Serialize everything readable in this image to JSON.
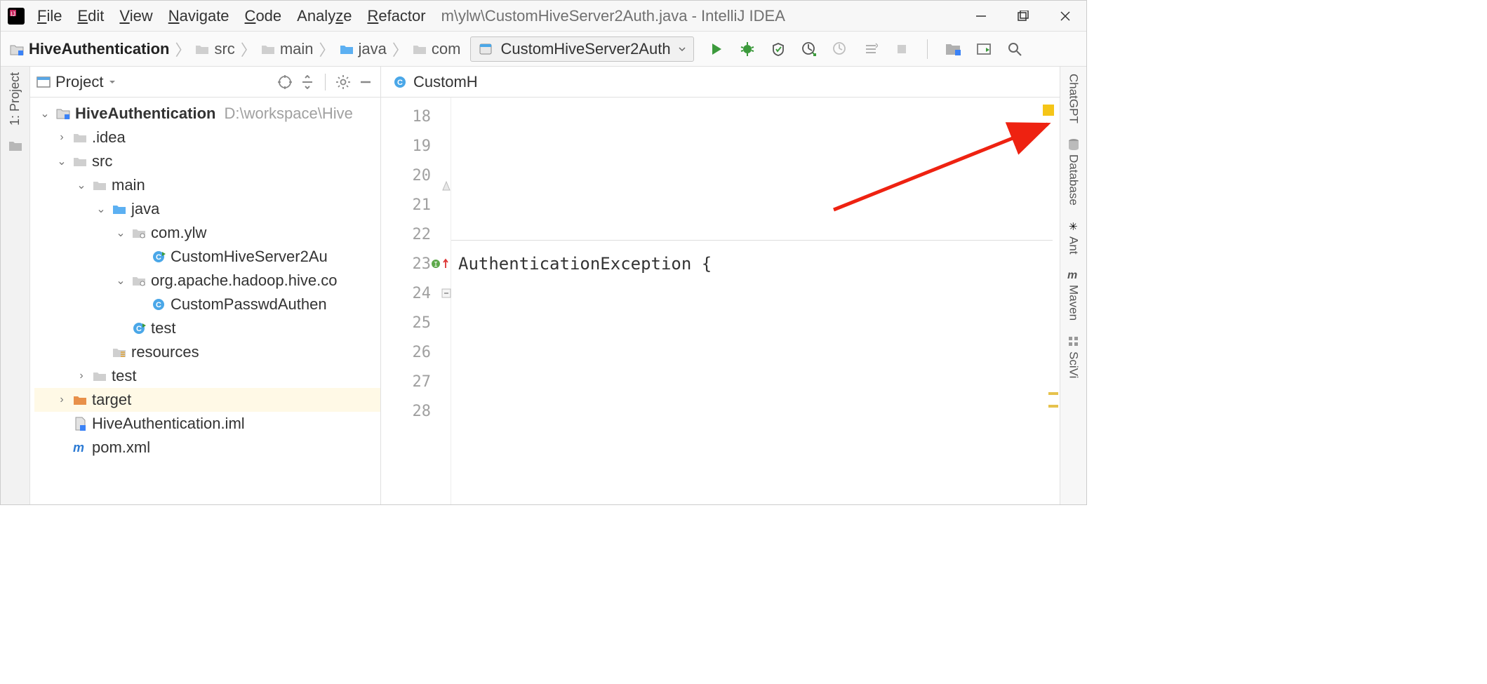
{
  "menu": {
    "file": "File",
    "edit": "Edit",
    "view": "View",
    "navigate": "Navigate",
    "code": "Code",
    "analyze": "Analyze",
    "refactor": "Refactor"
  },
  "title": "m\\ylw\\CustomHiveServer2Auth.java - IntelliJ IDEA",
  "breadcrumb": {
    "root": "HiveAuthentication",
    "src": "src",
    "main": "main",
    "java": "java",
    "com": "com"
  },
  "run_config": "CustomHiveServer2Auth",
  "project_panel": {
    "title": "Project"
  },
  "tree": {
    "root": {
      "name": "HiveAuthentication",
      "path": "D:\\workspace\\Hive"
    },
    "idea": ".idea",
    "src": "src",
    "main": "main",
    "java": "java",
    "pkg_com": "com.ylw",
    "cls_custom": "CustomHiveServer2Au",
    "pkg_hadoop": "org.apache.hadoop.hive.co",
    "cls_passwd": "CustomPasswdAuthen",
    "cls_test": "test",
    "resources": "resources",
    "test": "test",
    "target": "target",
    "iml": "HiveAuthentication.iml",
    "pom": "pom.xml"
  },
  "editor": {
    "tab_label": "CustomH",
    "line_start": 18,
    "line_end": 28,
    "code_line_23": "AuthenticationException {"
  },
  "left_rail": {
    "label": "1: Project"
  },
  "right_rail": {
    "chatgpt": "ChatGPT",
    "database": "Database",
    "ant": "Ant",
    "maven": "Maven",
    "sciv": "SciVi"
  }
}
